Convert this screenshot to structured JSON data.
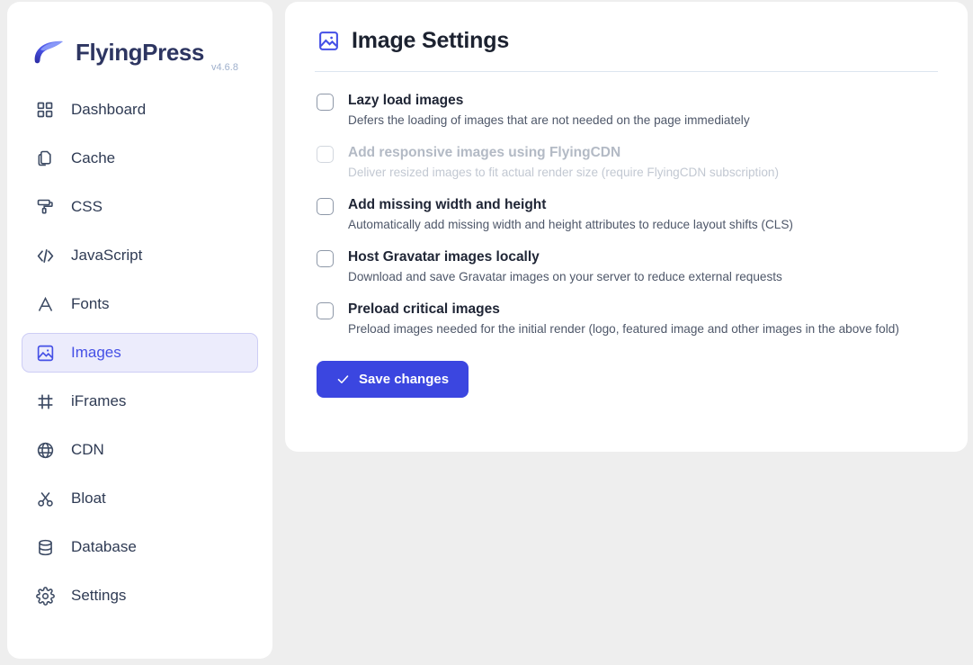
{
  "brand": {
    "name": "FlyingPress",
    "version": "v4.6.8",
    "logo_icon": "feather-wing-logo"
  },
  "sidebar": {
    "items": [
      {
        "label": "Dashboard",
        "icon": "grid-icon",
        "active": false
      },
      {
        "label": "Cache",
        "icon": "copy-files-icon",
        "active": false
      },
      {
        "label": "CSS",
        "icon": "paint-roller-icon",
        "active": false
      },
      {
        "label": "JavaScript",
        "icon": "code-brackets-icon",
        "active": false
      },
      {
        "label": "Fonts",
        "icon": "font-letter-a-icon",
        "active": false
      },
      {
        "label": "Images",
        "icon": "image-icon",
        "active": true
      },
      {
        "label": "iFrames",
        "icon": "crop-frame-icon",
        "active": false
      },
      {
        "label": "CDN",
        "icon": "globe-icon",
        "active": false
      },
      {
        "label": "Bloat",
        "icon": "scissors-icon",
        "active": false
      },
      {
        "label": "Database",
        "icon": "database-icon",
        "active": false
      },
      {
        "label": "Settings",
        "icon": "gear-icon",
        "active": false
      }
    ]
  },
  "main": {
    "title": "Image Settings",
    "title_icon": "image-icon",
    "options": [
      {
        "title": "Lazy load images",
        "description": "Defers the loading of images that are not needed on the page immediately",
        "checked": false,
        "disabled": false
      },
      {
        "title": "Add responsive images using FlyingCDN",
        "description": "Deliver resized images to fit actual render size (require FlyingCDN subscription)",
        "checked": false,
        "disabled": true
      },
      {
        "title": "Add missing width and height",
        "description": "Automatically add missing width and height attributes to reduce layout shifts (CLS)",
        "checked": false,
        "disabled": false
      },
      {
        "title": "Host Gravatar images locally",
        "description": "Download and save Gravatar images on your server to reduce external requests",
        "checked": false,
        "disabled": false
      },
      {
        "title": "Preload critical images",
        "description": "Preload images needed for the initial render (logo, featured image and other images in the above fold)",
        "checked": false,
        "disabled": false
      }
    ],
    "save_label": "Save changes",
    "save_icon": "check-icon"
  },
  "colors": {
    "accent": "#3b46e0",
    "accent_light": "#ececfc",
    "brand_text": "#2d3561",
    "page_background": "#eeeeee",
    "card_background": "#ffffff"
  }
}
